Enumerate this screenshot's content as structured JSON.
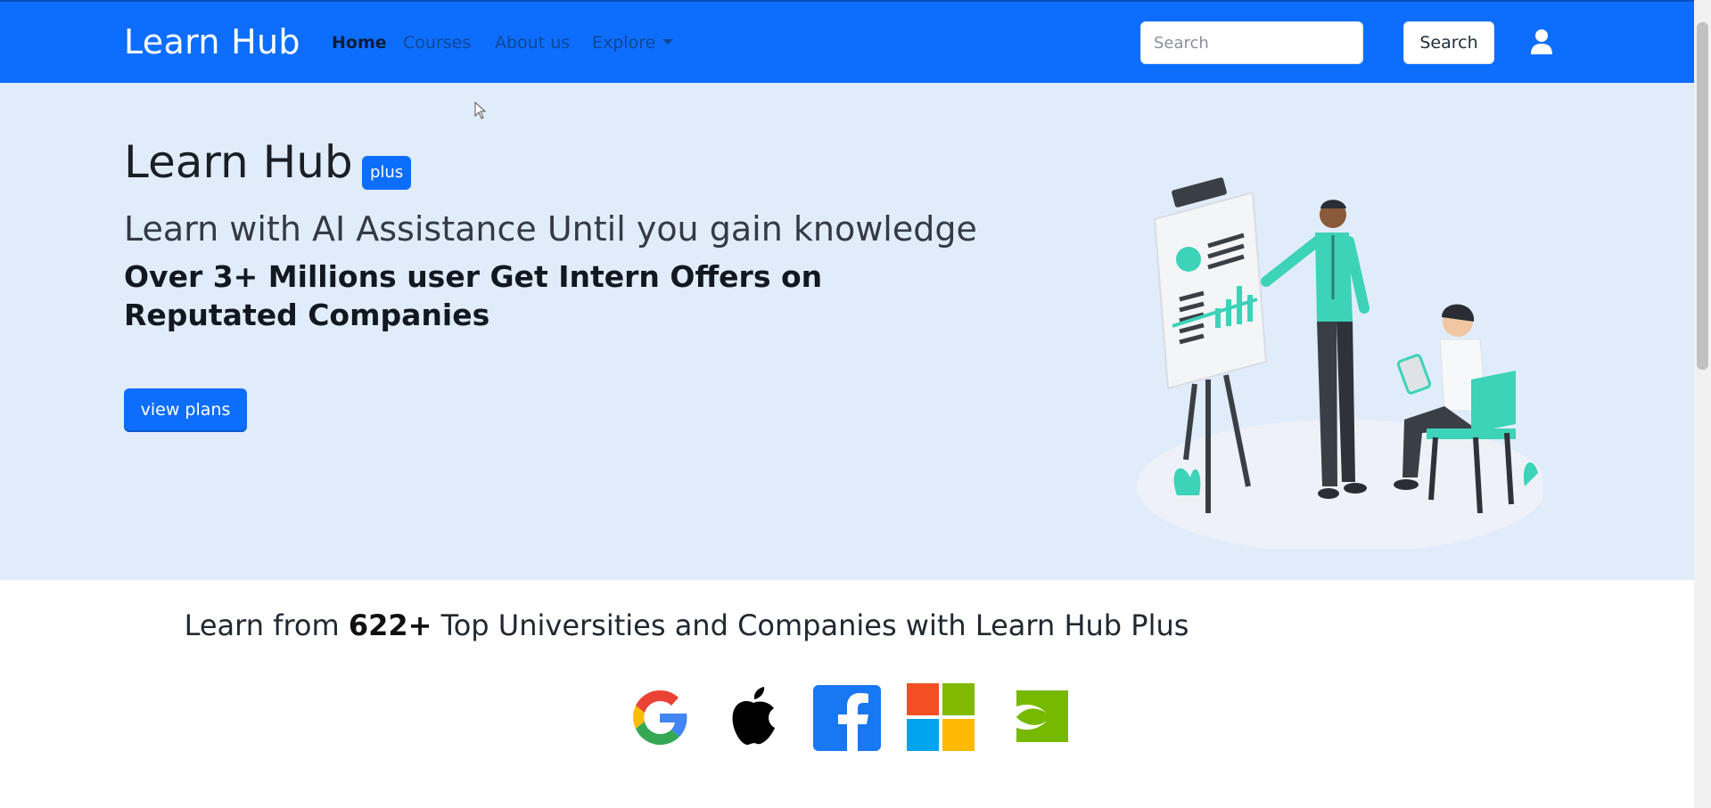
{
  "navbar": {
    "brand": "Learn Hub",
    "links": [
      {
        "label": "Home",
        "active": true
      },
      {
        "label": "Courses",
        "active": false
      },
      {
        "label": "About us",
        "active": false
      },
      {
        "label": "Explore",
        "active": false
      }
    ],
    "search_placeholder": "Search",
    "search_button": "Search",
    "user_icon": "user-icon"
  },
  "hero": {
    "title": "Learn Hub",
    "badge": "plus",
    "subtitle": "Learn with AI Assistance Until you gain knowledge",
    "tagline": "Over 3+ Millions user Get Intern Offers on Reputated Companies",
    "cta": "view plans",
    "illustration": "presentation-illustration"
  },
  "partners": {
    "prefix": "Learn from ",
    "count": "622+",
    "suffix": " Top Universities and Companies with Learn Hub Plus",
    "logos": [
      "google-logo",
      "apple-logo",
      "facebook-logo",
      "microsoft-logo",
      "nvidia-logo"
    ]
  },
  "colors": {
    "primary": "#0d6efd",
    "hero_bg": "#e1ecfb",
    "accent_teal": "#3cd3b8"
  }
}
